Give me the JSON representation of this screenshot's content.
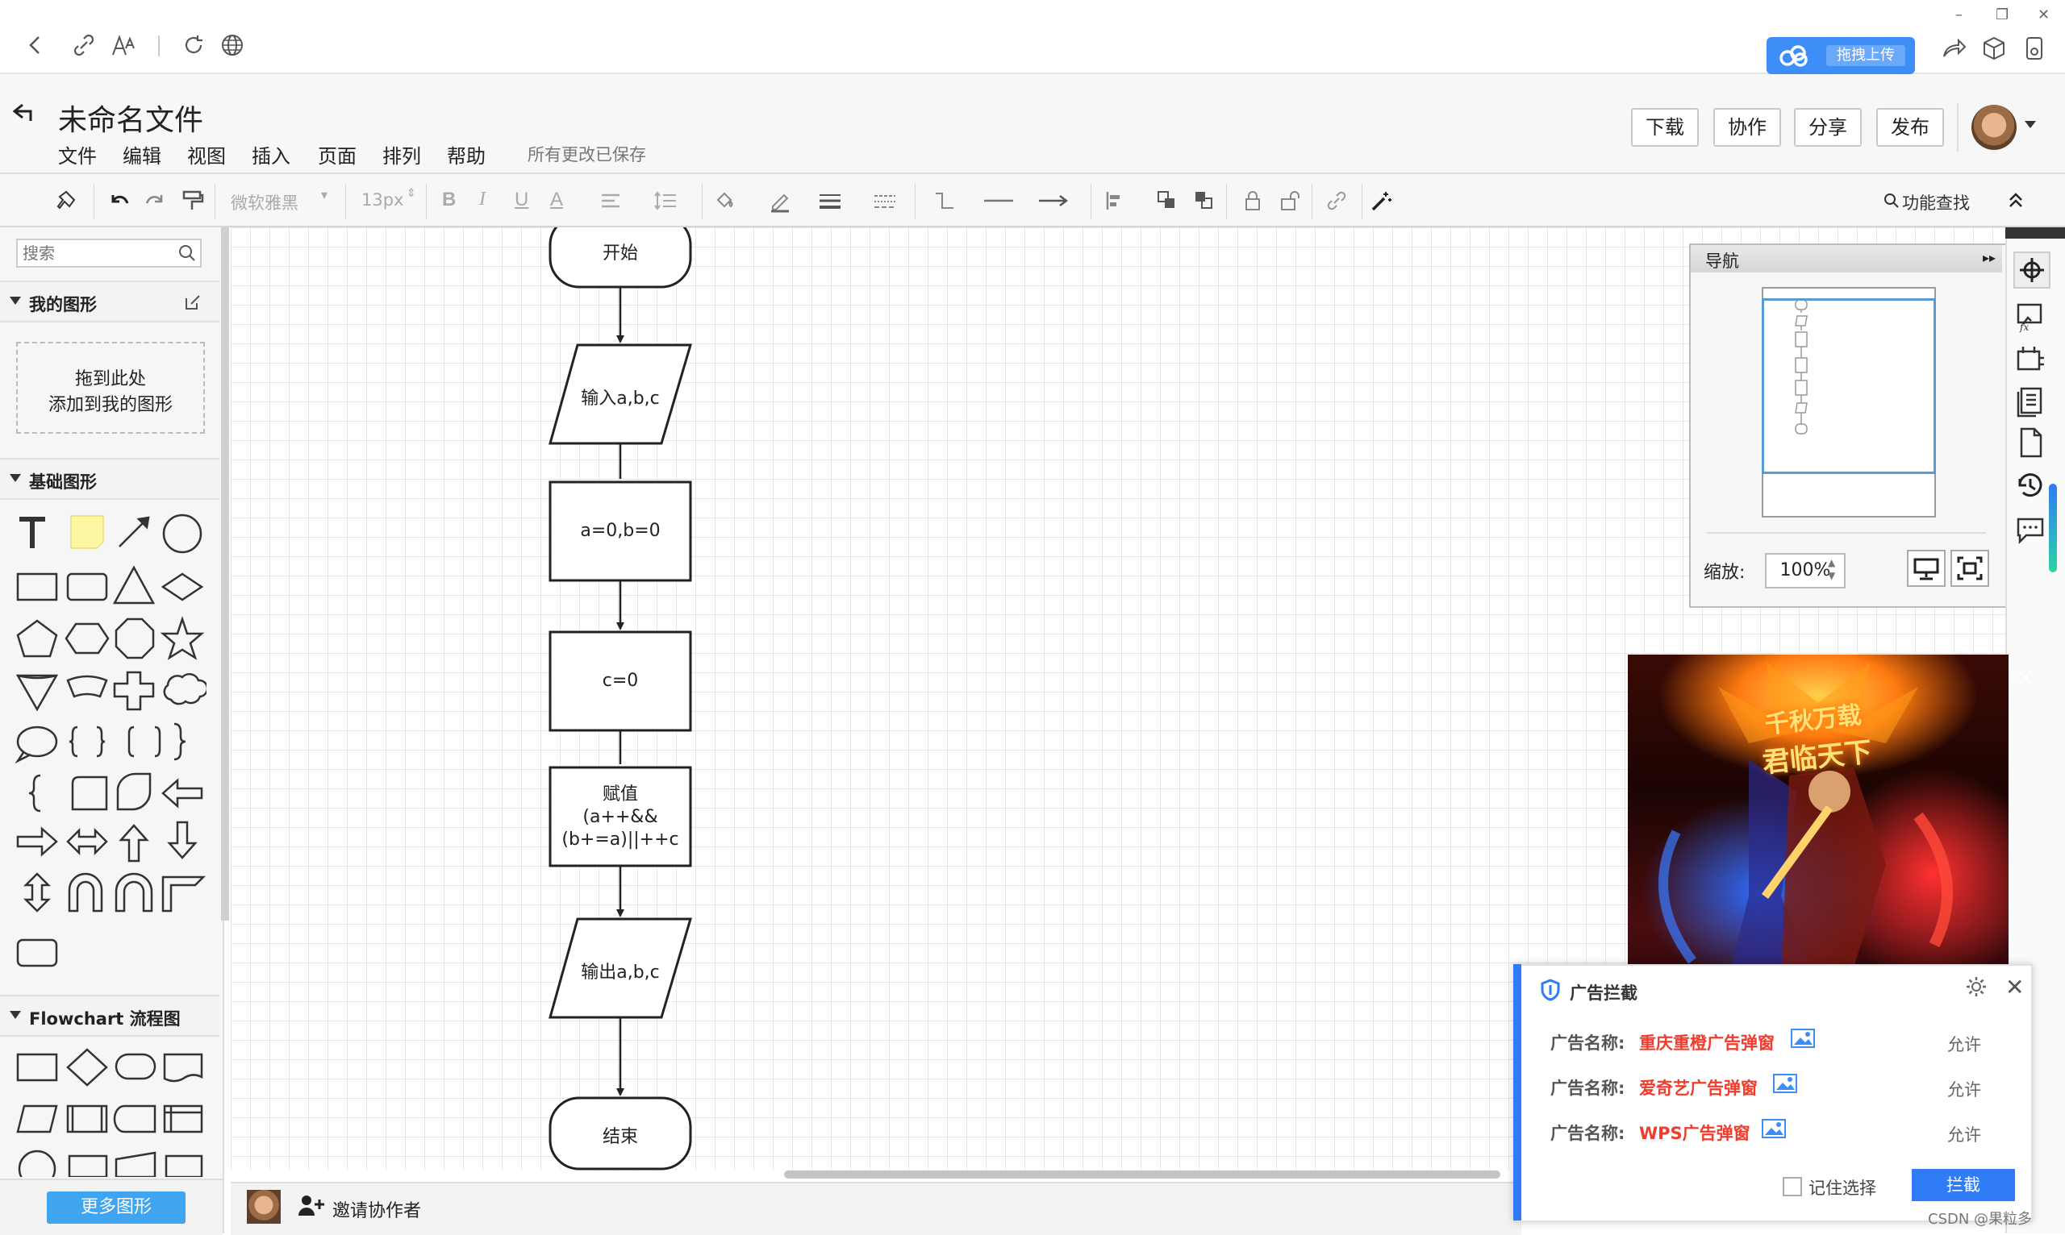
{
  "browser": {
    "cloud_button_label": "拖拽上传"
  },
  "header": {
    "title": "未命名文件",
    "menu": [
      "文件",
      "编辑",
      "视图",
      "插入",
      "页面",
      "排列",
      "帮助"
    ],
    "save_status": "所有更改已保存",
    "buttons": {
      "download": "下载",
      "collaborate": "协作",
      "share": "分享",
      "publish": "发布"
    }
  },
  "toolbar": {
    "font_family": "微软雅黑",
    "font_size": "13px",
    "bold": "B",
    "italic": "I",
    "underline": "U",
    "font_color": "A",
    "feature_search": "功能查找"
  },
  "left_panel": {
    "search_placeholder": "搜索",
    "my_shapes_title": "我的图形",
    "drop_zone_line1": "拖到此处",
    "drop_zone_line2": "添加到我的图形",
    "basic_shapes_title": "基础图形",
    "flowchart_title": "Flowchart 流程图",
    "more_shapes": "更多图形"
  },
  "flowchart": {
    "start": "开始",
    "input": "输入a,b,c",
    "assign1": "a=0,b=0",
    "assign2": "c=0",
    "assign3_line1": "赋值",
    "assign3_line2": "(a++&&",
    "assign3_line3": "(b+=a)||++c",
    "output": "输出a,b,c",
    "end": "结束"
  },
  "navigator": {
    "title": "导航",
    "zoom_label": "缩放:",
    "zoom_value": "100%"
  },
  "bottom_bar": {
    "invite": "邀请协作者"
  },
  "ad_video": {
    "title_text": "千秋万载",
    "subtitle_text": "君临天下"
  },
  "ad_block": {
    "title": "广告拦截",
    "rows": [
      {
        "label": "广告名称:",
        "name": "重庆重橙广告弹窗",
        "action": "允许"
      },
      {
        "label": "广告名称:",
        "name": "爱奇艺广告弹窗",
        "action": "允许"
      },
      {
        "label": "广告名称:",
        "name": "WPS广告弹窗",
        "action": "允许"
      }
    ],
    "remember": "记住选择",
    "block_button": "拦截"
  },
  "watermark": "CSDN @果粒多",
  "colors": {
    "accent_blue": "#2f7cf6",
    "ad_name_red": "#f03c2d",
    "more_shapes_blue": "#3fa5f0",
    "note_yellow": "#fdf6a3"
  }
}
